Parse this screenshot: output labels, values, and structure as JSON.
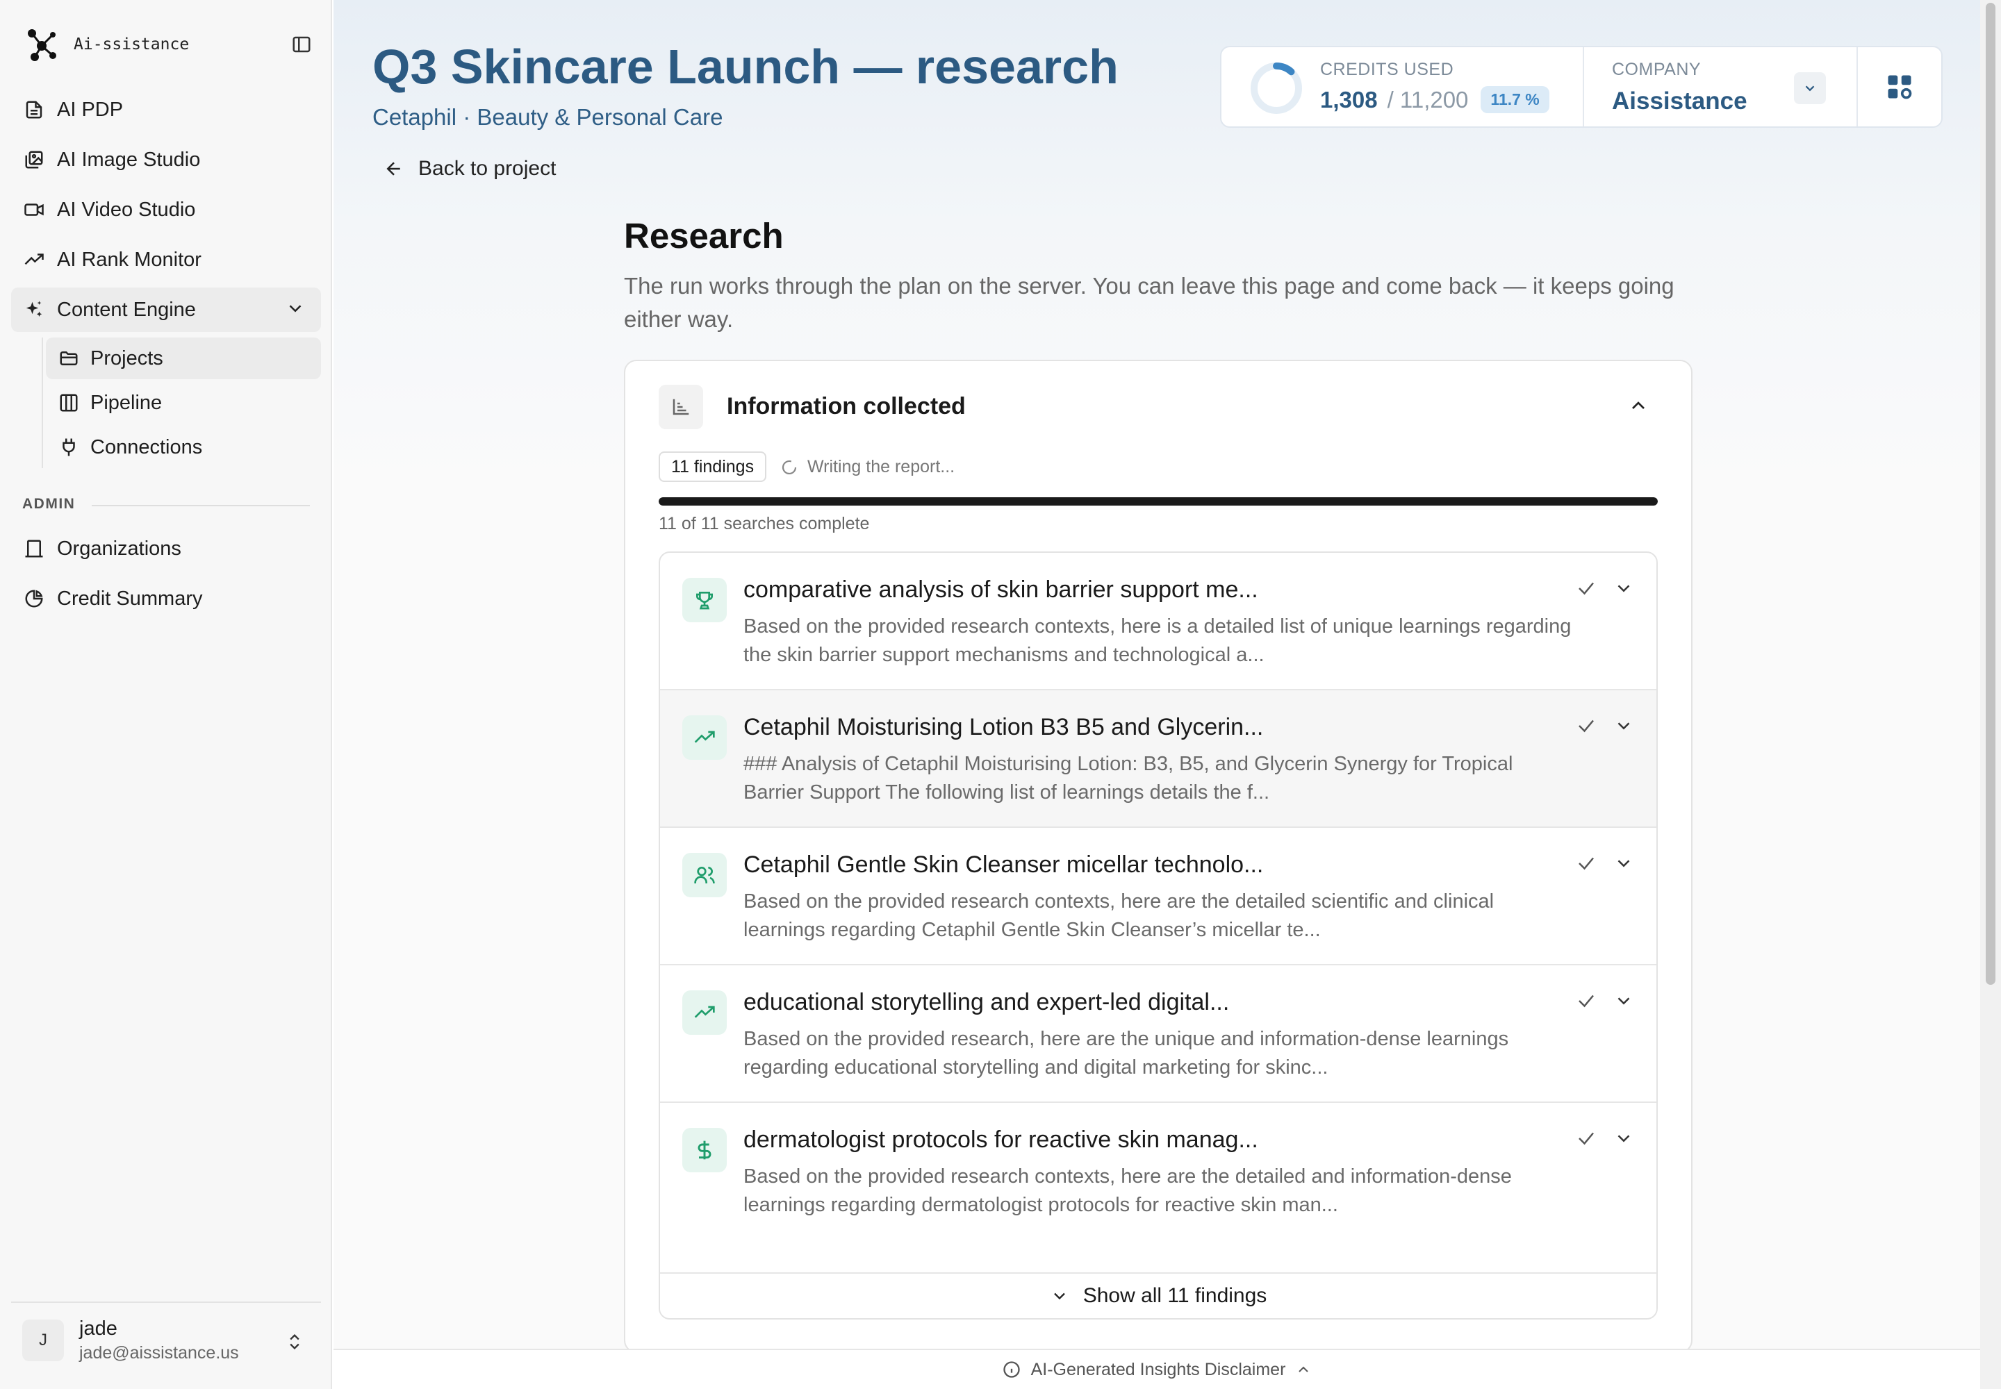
{
  "app": {
    "name": "Ai-ssistance"
  },
  "sidebar": {
    "items": [
      {
        "label": "AI PDP",
        "icon": "document-icon"
      },
      {
        "label": "AI Image Studio",
        "icon": "image-gallery-icon"
      },
      {
        "label": "AI Video Studio",
        "icon": "video-icon"
      },
      {
        "label": "AI Rank Monitor",
        "icon": "trending-up-icon"
      },
      {
        "label": "Content Engine",
        "icon": "sparkles-icon",
        "expanded": true
      }
    ],
    "subitems": [
      {
        "label": "Projects",
        "icon": "folder-icon",
        "active": true
      },
      {
        "label": "Pipeline",
        "icon": "columns-icon"
      },
      {
        "label": "Connections",
        "icon": "plug-icon"
      }
    ],
    "admin_label": "ADMIN",
    "admin_items": [
      {
        "label": "Organizations",
        "icon": "building-icon"
      },
      {
        "label": "Credit Summary",
        "icon": "pie-chart-icon"
      }
    ],
    "user": {
      "initial": "J",
      "name": "jade",
      "email": "jade@aissistance.us"
    }
  },
  "header": {
    "title": "Q3 Skincare Launch — research",
    "subtitle": "Cetaphil · Beauty & Personal Care",
    "back_label": "Back to project"
  },
  "credits": {
    "label": "CREDITS USED",
    "used": "1,308",
    "total": "/ 11,200",
    "percent": "11.7 %",
    "fraction": 0.117,
    "company_label": "COMPANY",
    "company": "Aissistance"
  },
  "research": {
    "title": "Research",
    "description": "The run works through the plan on the server. You can leave this page and come back — it keeps going either way."
  },
  "panel": {
    "title": "Information collected",
    "findings_badge": "11 findings",
    "status": "Writing the report...",
    "progress_fraction": 1.0,
    "progress_text": "11 of 11 searches complete",
    "show_all": "Show all 11 findings",
    "findings": [
      {
        "icon": "trophy-icon",
        "title": "comparative analysis of skin barrier support me...",
        "body": "Based on the provided research contexts, here is a detailed list of unique learnings regarding the skin barrier support mechanisms and technological a..."
      },
      {
        "icon": "trending-up-icon",
        "title": "Cetaphil Moisturising Lotion B3 B5 and Glycerin...",
        "body": "### Analysis of Cetaphil Moisturising Lotion: B3, B5, and Glycerin Synergy for Tropical Barrier Support The following list of learnings details the f..."
      },
      {
        "icon": "users-icon",
        "title": "Cetaphil Gentle Skin Cleanser micellar technolo...",
        "body": "Based on the provided research contexts, here are the detailed scientific and clinical learnings regarding Cetaphil Gentle Skin Cleanser’s micellar te..."
      },
      {
        "icon": "trending-up-icon",
        "title": "educational storytelling and expert-led digital...",
        "body": "Based on the provided research, here are the unique and information-dense learnings regarding educational storytelling and digital marketing for skinc..."
      },
      {
        "icon": "dollar-icon",
        "title": "dermatologist protocols for reactive skin manag...",
        "body": "Based on the provided research contexts, here are the detailed and information-dense learnings regarding dermatologist protocols for reactive skin man..."
      }
    ]
  },
  "footer": {
    "disclaimer": "AI-Generated Insights Disclaimer"
  },
  "colors": {
    "title_blue": "#2c5a82",
    "accent_green": "#1f9d6b",
    "progress": "#1a1a1a",
    "badge_blue": "#3d86c4"
  }
}
